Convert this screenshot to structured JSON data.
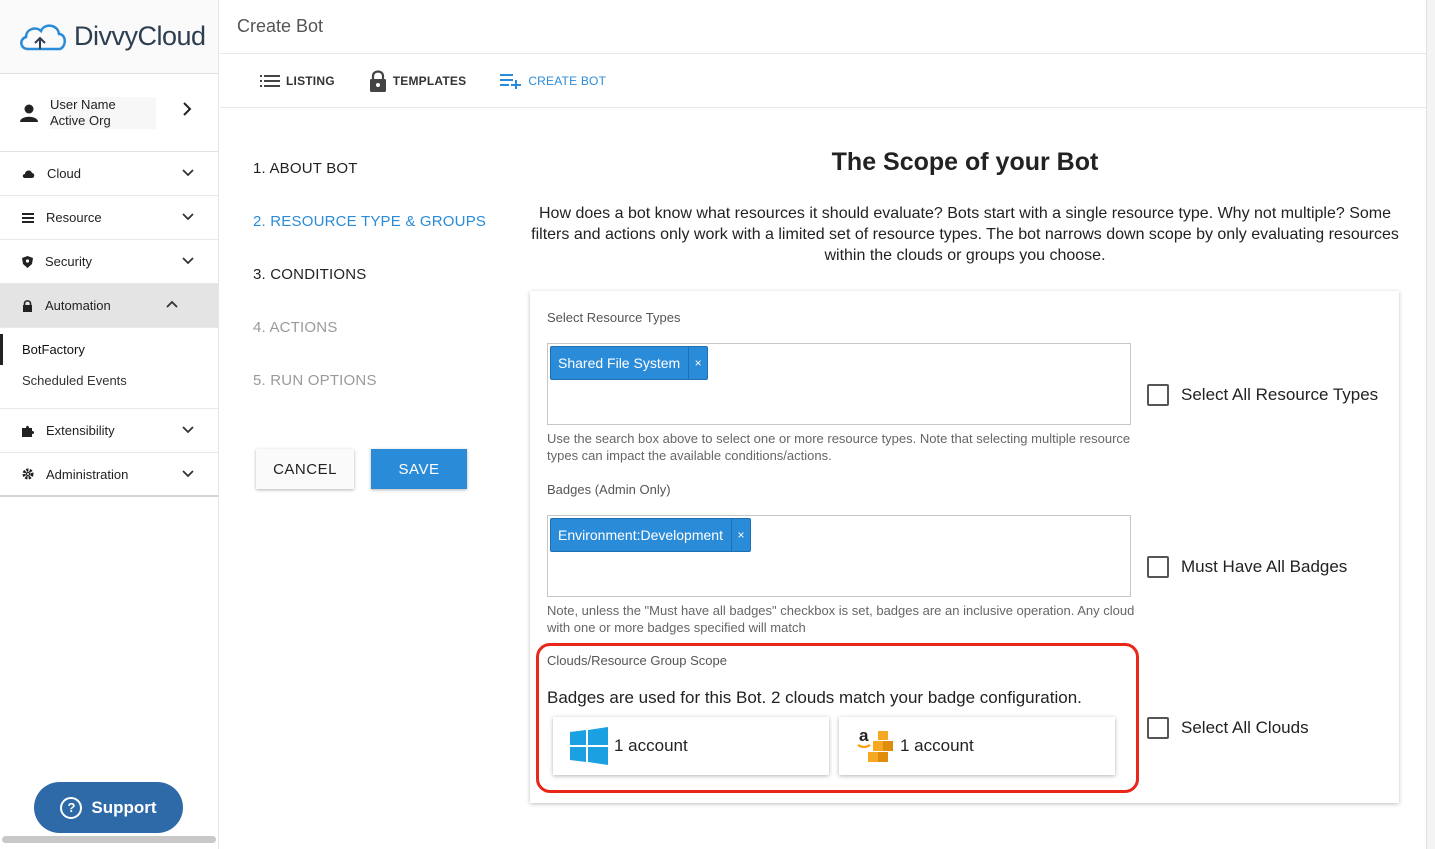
{
  "brand": {
    "name": "DivvyCloud"
  },
  "user": {
    "name": "User Name",
    "org": "Active Org"
  },
  "nav": {
    "items": [
      {
        "label": "Cloud",
        "icon": "cloud-icon"
      },
      {
        "label": "Resource",
        "icon": "list-icon"
      },
      {
        "label": "Security",
        "icon": "shield-icon"
      },
      {
        "label": "Automation",
        "icon": "lock-icon"
      },
      {
        "label": "Extensibility",
        "icon": "puzzle-icon"
      },
      {
        "label": "Administration",
        "icon": "gear-icon"
      }
    ],
    "automation_sub": [
      "BotFactory",
      "Scheduled Events"
    ]
  },
  "support": {
    "label": "Support"
  },
  "page": {
    "title": "Create Bot"
  },
  "tabs": [
    {
      "label": "LISTING",
      "icon": "list-icon"
    },
    {
      "label": "TEMPLATES",
      "icon": "lock-icon"
    },
    {
      "label": "CREATE BOT",
      "icon": "add-list-icon"
    }
  ],
  "steps": [
    "1. ABOUT BOT",
    "2. RESOURCE TYPE & GROUPS",
    "3. CONDITIONS",
    "4. ACTIONS",
    "5. RUN OPTIONS"
  ],
  "buttons": {
    "cancel": "CANCEL",
    "save": "SAVE"
  },
  "scope": {
    "title": "The Scope of your Bot",
    "description": "How does a bot know what resources it should evaluate? Bots start with a single resource type. Why not multiple? Some filters and actions only work with a limited set of resource types. The bot narrows down scope by only evaluating resources within the clouds or groups you choose."
  },
  "form": {
    "resource_types": {
      "label": "Select Resource Types",
      "chip": "Shared File System",
      "help": "Use the search box above to select one or more resource types. Note that selecting multiple resource types can impact the available conditions/actions.",
      "select_all": "Select All Resource Types"
    },
    "badges": {
      "label": "Badges (Admin Only)",
      "chip": "Environment:Development",
      "help": "Note, unless the \"Must have all badges\" checkbox is set, badges are an inclusive operation. Any cloud with one or more badges specified will match",
      "must_have_all": "Must Have All Badges"
    },
    "clouds": {
      "label": "Clouds/Resource Group Scope",
      "message": "Badges are used for this Bot. 2 clouds match your badge configuration.",
      "accounts": [
        {
          "provider_icon": "windows-icon",
          "label": "1 account"
        },
        {
          "provider_icon": "aws-icon",
          "label": "1 account"
        }
      ],
      "select_all": "Select All Clouds"
    }
  },
  "chip_remove": "×",
  "colors": {
    "accent": "#2a8bd8",
    "highlight": "#e8261a",
    "support": "#2e6aa8"
  }
}
